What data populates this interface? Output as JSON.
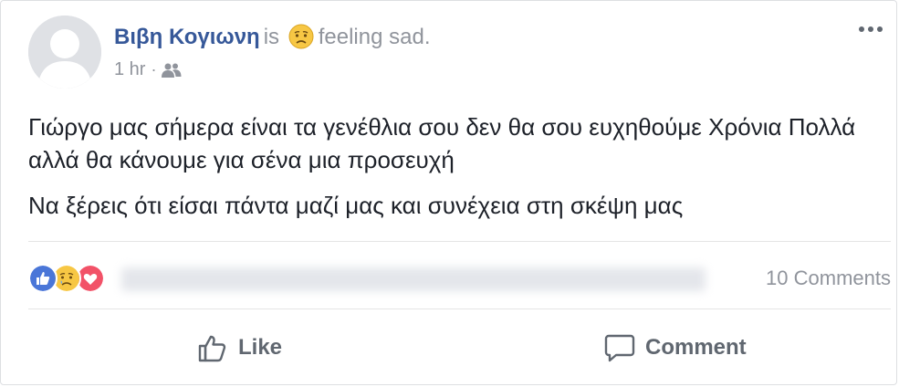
{
  "post": {
    "author": "Βιβη Κογιωνη",
    "is_word": "is",
    "feeling_text": "feeling sad.",
    "feeling_icon": "sad-face-icon",
    "timestamp": "1 hr",
    "separator": "·",
    "privacy_icon": "friends-icon",
    "paragraphs": [
      "Γιώργο μας σήμερα είναι τα γενέθλια σου δεν θα σου ευχηθούμε Χρόνια Πολλά αλλά θα κάνουμε για σένα μια προσευχή",
      "Να ξέρεις ότι είσαι πάντα μαζί μας και συνέχεια στη σκέψη μας"
    ]
  },
  "reactions": {
    "icons": [
      "like-reaction-icon",
      "sad-reaction-icon",
      "love-reaction-icon"
    ],
    "colors": {
      "like": "#4a76d8",
      "sad": "#f7c744",
      "love": "#f25268"
    }
  },
  "comments_label": "10 Comments",
  "actions": {
    "like_label": "Like",
    "comment_label": "Comment"
  },
  "colors": {
    "name": "#365899",
    "muted": "#90949c",
    "text": "#1d2129",
    "action": "#606770"
  }
}
